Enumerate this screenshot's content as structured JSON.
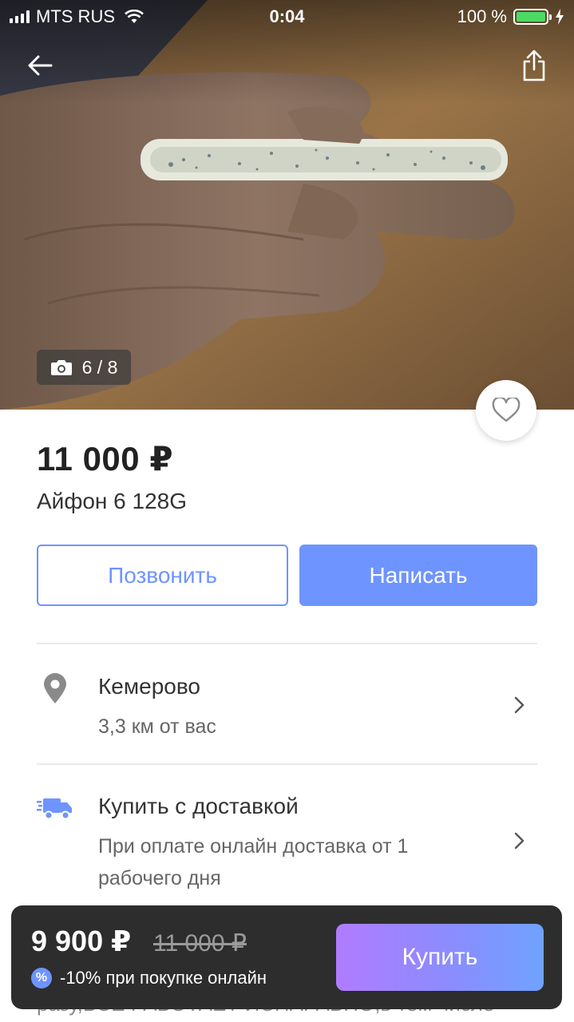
{
  "status_bar": {
    "carrier": "MTS RUS",
    "time": "0:04",
    "battery": "100 %",
    "battery_level": 1.0
  },
  "gallery": {
    "counter": "6 / 8",
    "current": 6,
    "total": 8
  },
  "listing": {
    "price": "11 000 ₽",
    "title": "Айфон 6 128G"
  },
  "actions": {
    "call_label": "Позвонить",
    "write_label": "Написать"
  },
  "location": {
    "city": "Кемерово",
    "distance": "3,3 км от вас"
  },
  "delivery": {
    "title": "Купить с доставкой",
    "description": "При оплате онлайн доставка от 1 рабочего дня"
  },
  "description_peek": "разу,ВСЕ РАБОТАЕТ ИСПАРАВНО,в том числе",
  "buy_bar": {
    "sale_price": "9 900 ₽",
    "old_price": "11 000 ₽",
    "discount_badge": "%",
    "discount_text": "-10% при покупке онлайн",
    "buy_label": "Купить"
  },
  "colors": {
    "accent": "#6e94ff",
    "buy_gradient_start": "#b07cff",
    "buy_gradient_end": "#6fa2ff",
    "bar_background": "#2d2d2d"
  },
  "icons": {
    "back": "arrow-left-icon",
    "share": "share-icon",
    "camera": "camera-icon",
    "favorite": "heart-outline-icon",
    "location": "map-pin-icon",
    "delivery": "truck-icon",
    "chevron": "chevron-right-icon"
  }
}
